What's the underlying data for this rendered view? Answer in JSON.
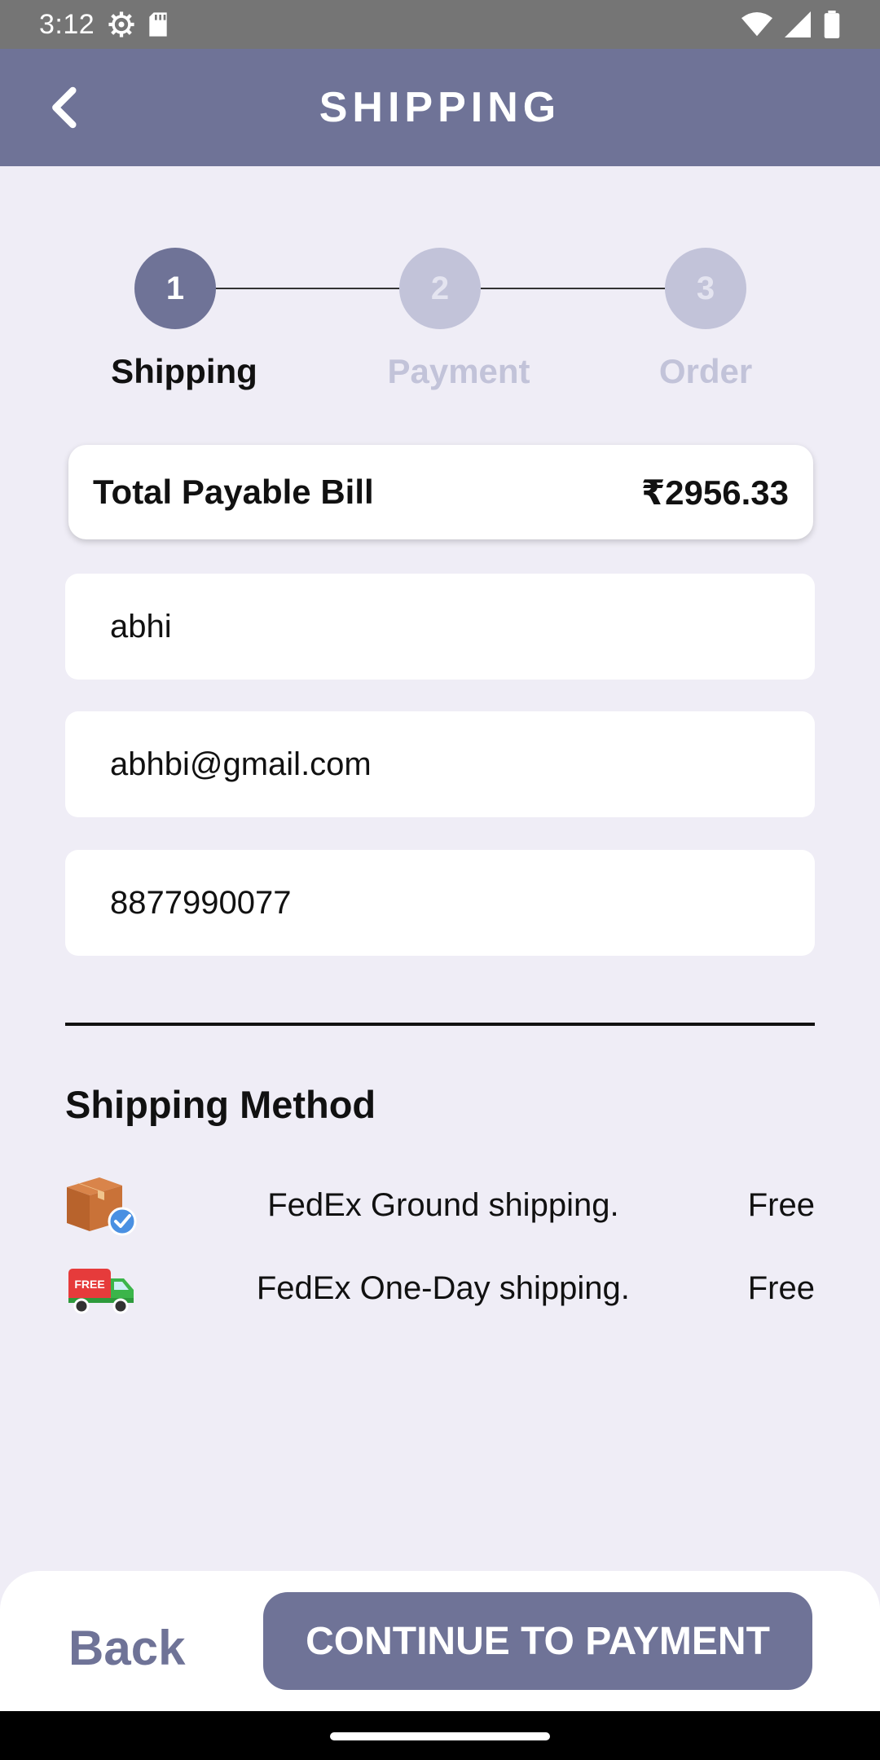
{
  "status_bar": {
    "time": "3:12",
    "icons": [
      "settings-icon",
      "sd-card-icon",
      "wifi-icon",
      "signal-icon",
      "battery-icon"
    ]
  },
  "app_bar": {
    "title": "SHIPPING",
    "back_icon": "chevron-left-icon"
  },
  "stepper": {
    "steps": [
      {
        "number": "1",
        "label": "Shipping",
        "active": true
      },
      {
        "number": "2",
        "label": "Payment",
        "active": false
      },
      {
        "number": "3",
        "label": "Order",
        "active": false
      }
    ]
  },
  "bill": {
    "label": "Total Payable Bill",
    "amount": "₹2956.33"
  },
  "form": {
    "name": "abhi",
    "email": "abhbi@gmail.com",
    "phone": "8877990077"
  },
  "shipping_method": {
    "title": "Shipping Method",
    "options": [
      {
        "name": "FedEx Ground shipping.",
        "price": "Free",
        "icon": "package-check-icon"
      },
      {
        "name": "FedEx One-Day shipping.",
        "price": "Free",
        "icon": "free-delivery-truck-icon",
        "badge": "FREE"
      }
    ]
  },
  "footer": {
    "back_label": "Back",
    "continue_label": "CONTINUE TO PAYMENT"
  },
  "colors": {
    "primary": "#6f7397",
    "background": "#efedf6",
    "inactive_step": "#c2c3d9"
  }
}
